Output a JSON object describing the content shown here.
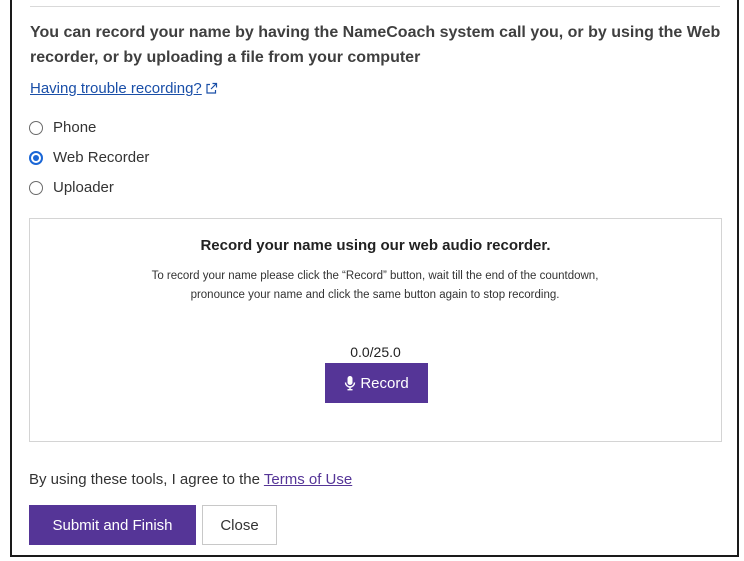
{
  "intro": {
    "text": "You can record your name by having the NameCoach system call you, or by using the Web recorder, or by uploading a file from your computer"
  },
  "help": {
    "trouble_link": "Having trouble recording?",
    "trouble_icon": "external-link-icon"
  },
  "methods": {
    "selected": "Web Recorder",
    "options": [
      {
        "label": "Phone",
        "checked": false
      },
      {
        "label": "Web Recorder",
        "checked": true
      },
      {
        "label": "Uploader",
        "checked": false
      }
    ]
  },
  "recorder": {
    "title": "Record your name using our web audio recorder.",
    "description": "To record your name please click the “Record” button, wait till the end of the countdown, pronounce your name and click the same button again to stop recording.",
    "timer": "0.0/25.0",
    "record_label": "Record",
    "record_icon": "microphone-icon"
  },
  "footer": {
    "agree_text": "By using these tools, I agree to the ",
    "terms_link": "Terms of Use",
    "submit_label": "Submit and Finish",
    "close_label": "Close"
  },
  "colors": {
    "accent": "#553597",
    "link": "#1a4fa8",
    "radio_selected": "#1a66d6"
  }
}
